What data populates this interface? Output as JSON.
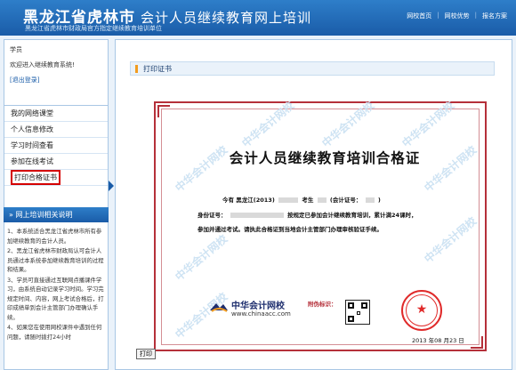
{
  "header": {
    "title": "黑龙江省虎林市",
    "subtitle": "会计人员继续教育网上培训",
    "tagline": "黑龙江省虎林市财政局官方指定继续教育培训单位",
    "nav": [
      "网校首页",
      "网校优势",
      "报名方案"
    ]
  },
  "user": {
    "label": "学员",
    "welcome": "欢迎进入继续教育系统!",
    "logout": "[退出登录]"
  },
  "menu": [
    {
      "label": "我的网络课堂"
    },
    {
      "label": "个人信息修改"
    },
    {
      "label": "学习时间查看"
    },
    {
      "label": "参加在线考试"
    },
    {
      "label": "打印合格证书",
      "active": true
    }
  ],
  "info": {
    "title": "网上培训相关说明",
    "items": [
      "1、本系统适合黑龙江省虎林市所有参加继续教育的会计人员。",
      "2、黑龙江省虎林市财政局认可会计人员通过本系统参加继续教育培训的过程和结果。",
      "3、学员可直接通过互联网点播课件学习，由系统自动记录学习时间。学习完规定时间、内容，网上考试合格后，打印成绩单到会计主管部门办理确认手续。",
      "4、如果您在使用网校课件中遇到任何问题，请随时拨打24小时"
    ]
  },
  "main": {
    "section_title": "打印证书",
    "print_button": "打印"
  },
  "certificate": {
    "title": "会计人员继续教育培训合格证",
    "line1_prefix": "今有",
    "name": "黑龙江(2013)",
    "line1_mid": "考生",
    "line1_cert": "(会计证号：",
    "line1_end": ")",
    "line2_prefix": "身份证号：",
    "line2_text": "按规定已参加会计继续教育培训，累计满24课时，",
    "line3_text": "参加并通过考试。请执此合格证到当地会计主管部门办理审核验证手续。",
    "attachment_label": "附伪标识：",
    "brand_name": "中华会计网校",
    "brand_url": "www.chinaacc.com",
    "date": "2013 年08 月23 日",
    "watermark": "中华会计网校"
  },
  "colors": {
    "brand_blue": "#1a5ca8",
    "cert_red": "#b5303a",
    "seal_red": "#e02a2a",
    "highlight_red": "#d40000"
  }
}
